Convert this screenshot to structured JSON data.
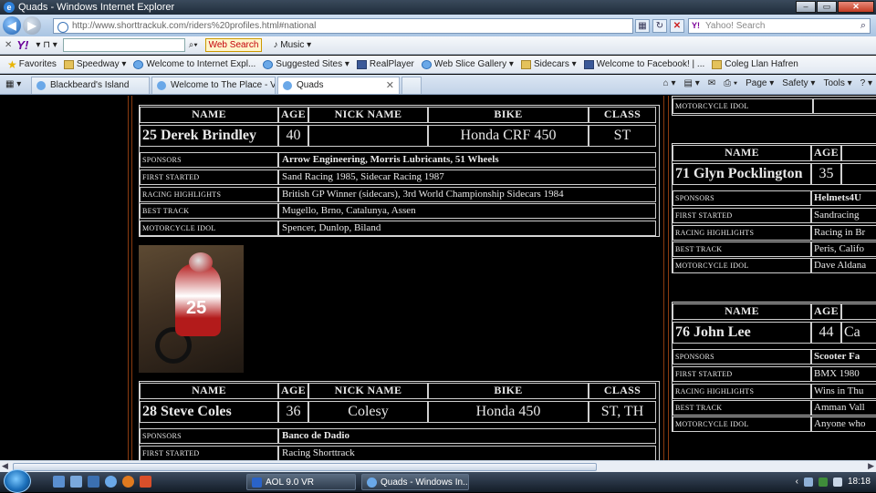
{
  "window": {
    "title": "Quads - Windows Internet Explorer"
  },
  "address": {
    "url": "http://www.shorttrackuk.com/riders%20profiles.html#national"
  },
  "search": {
    "placeholder": "Yahoo! Search"
  },
  "yahoo_toolbar": {
    "web_search_label": "Web Search",
    "music_label": "Music"
  },
  "favorites": {
    "label": "Favorites",
    "items": [
      "Speedway",
      "Welcome to Internet Expl...",
      "Suggested Sites",
      "RealPlayer",
      "Web Slice Gallery",
      "Sidecars",
      "Welcome to Facebook! | ...",
      "Coleg Llan Hafren"
    ]
  },
  "tabs": [
    {
      "label": "Blackbeard's Island"
    },
    {
      "label": "Welcome to The Place - Vi..."
    },
    {
      "label": "Quads"
    }
  ],
  "tab_tools": {
    "page": "Page",
    "safety": "Safety",
    "tools": "Tools"
  },
  "headers": {
    "name": "NAME",
    "age": "AGE",
    "nick": "NICK NAME",
    "bike": "BIKE",
    "class": "CLASS"
  },
  "labels": {
    "sponsors": "SPONSORS",
    "first_started": "FIRST STARTED",
    "racing_highlights": "RACING HIGHLIGHTS",
    "best_track": "BEST TRACK",
    "motorcycle_idol": "MOTORCYCLE IDOL"
  },
  "riders": [
    {
      "name": "25 Derek Brindley",
      "age": "40",
      "nick": "",
      "bike": "Honda CRF 450",
      "class": "ST",
      "sponsors": "Arrow Engineering, Morris Lubricants, 51 Wheels",
      "first_started": "Sand Racing 1985, Sidecar Racing 1987",
      "racing_highlights": "British GP Winner (sidecars), 3rd World Championship Sidecars 1984",
      "best_track": "Mugello, Brno, Catalunya, Assen",
      "motorcycle_idol": "Spencer, Dunlop, Biland"
    },
    {
      "name": "28 Steve Coles",
      "age": "36",
      "nick": "Colesy",
      "bike": "Honda 450",
      "class": "ST, TH",
      "sponsors": "Banco de Dadio",
      "first_started": "Racing Shorttrack"
    }
  ],
  "right_riders": [
    {
      "name": "71 Glyn Pocklington",
      "age": "35",
      "sponsors": "Helmets4U",
      "first_started": "Sandracing",
      "racing_highlights": "Racing in Br",
      "best_track": "Peris, Califo",
      "motorcycle_idol": "Dave Aldana"
    },
    {
      "name": "76 John Lee",
      "age": "44",
      "nick": "Ca",
      "sponsors": "Scooter Fa",
      "first_started": "BMX 1980",
      "racing_highlights": "Wins in Thu",
      "best_track": "Amman Vall",
      "motorcycle_idol": "Anyone who"
    }
  ],
  "taskbar": {
    "tasks": [
      "AOL 9.0 VR",
      "Quads - Windows In..."
    ],
    "clock": "18:18"
  }
}
